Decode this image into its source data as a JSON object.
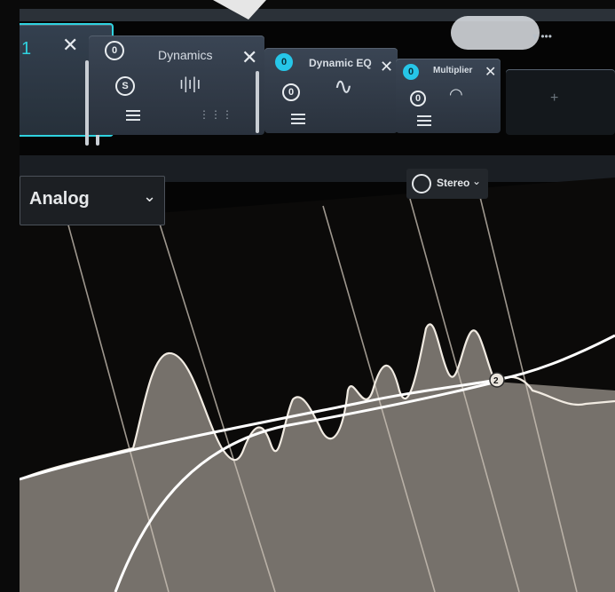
{
  "tabs": {
    "partial_label": "1",
    "modules": [
      {
        "title": "Dynamics",
        "btn1": "0",
        "btn2": "S"
      },
      {
        "title": "Dynamic EQ",
        "btn1": "0",
        "btn2": "0"
      },
      {
        "title": "Multiplier",
        "btn1": "0",
        "btn2": "0"
      }
    ],
    "add_label": "+"
  },
  "toolbar": {
    "mode_value": "Analog",
    "channel_value": "Stereo"
  },
  "colors": {
    "accent": "#2fd2e0",
    "active_button": "#26c6e8",
    "panel": "#313a46",
    "graph_bg": "#0b0a09",
    "curve": "#e9e2d8"
  },
  "icons": [
    "close-icon",
    "power-icon",
    "solo-icon",
    "list-icon",
    "waveform-icon",
    "eq-curve-icon",
    "gauge-icon",
    "chevron-down-icon",
    "stereo-icon"
  ],
  "graph": {
    "node_label": "2"
  }
}
